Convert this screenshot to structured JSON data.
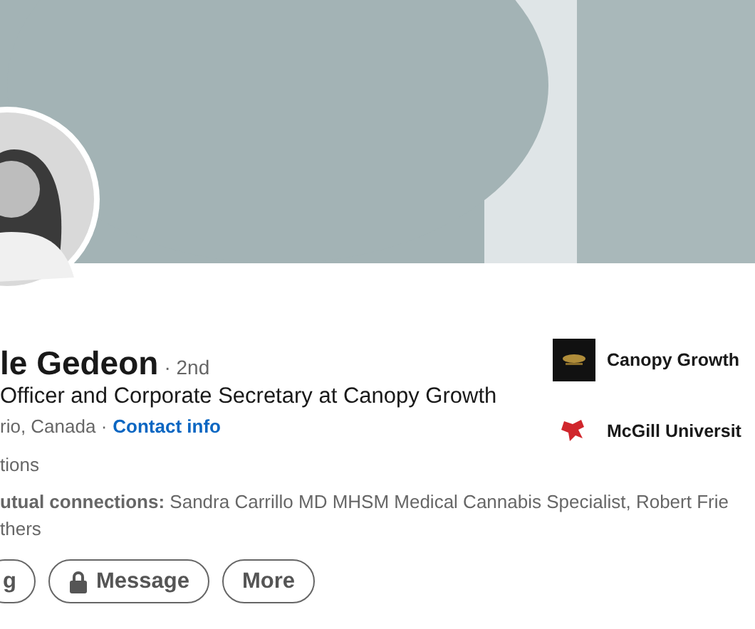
{
  "profile": {
    "name": "le Gedeon",
    "degree": "· 2nd",
    "headline": "Officer and Corporate Secretary at Canopy Growth",
    "location": "rio, Canada ·",
    "contact_link": "Contact info",
    "connections": "tions",
    "mutual_line_1": "**utual connections:** Sandra Carrillo MD MHSM Medical Cannabis Specialist, Robert Frie",
    "mutual_line_2": "thers"
  },
  "experience": [
    {
      "kind": "company",
      "name": "Canopy Growth"
    },
    {
      "kind": "school",
      "name": "McGill Universit"
    }
  ],
  "buttons": [
    {
      "kind": "plain",
      "label": "g"
    },
    {
      "kind": "locked",
      "label": "Message"
    },
    {
      "kind": "plain",
      "label": "More"
    }
  ]
}
